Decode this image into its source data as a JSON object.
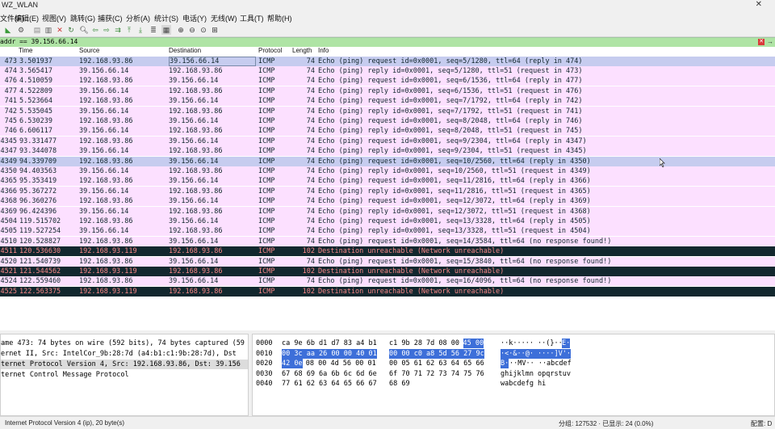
{
  "window": {
    "title": "WZ_WLAN"
  },
  "menu": [
    "文件(F)",
    "编辑(E)",
    "视图(V)",
    "跳转(G)",
    "捕获(C)",
    "分析(A)",
    "统计(S)",
    "电话(Y)",
    "无线(W)",
    "工具(T)",
    "帮助(H)"
  ],
  "filter": {
    "text": "addr == 39.156.66.14"
  },
  "columns": {
    "time": "Time",
    "source": "Source",
    "destination": "Destination",
    "protocol": "Protocol",
    "length": "Length",
    "info": "Info"
  },
  "packets": [
    {
      "no": "473",
      "time": "3.501937",
      "src": "192.168.93.86",
      "dst": "39.156.66.14",
      "proto": "ICMP",
      "len": "74",
      "info": "Echo (ping) request  id=0x0001, seq=5/1280, ttl=64 (reply in 474)",
      "style": "sel"
    },
    {
      "no": "474",
      "time": "3.565417",
      "src": "39.156.66.14",
      "dst": "192.168.93.86",
      "proto": "ICMP",
      "len": "74",
      "info": "Echo (ping) reply    id=0x0001, seq=5/1280, ttl=51 (request in 473)",
      "style": "pink"
    },
    {
      "no": "476",
      "time": "4.510059",
      "src": "192.168.93.86",
      "dst": "39.156.66.14",
      "proto": "ICMP",
      "len": "74",
      "info": "Echo (ping) request  id=0x0001, seq=6/1536, ttl=64 (reply in 477)",
      "style": "pink"
    },
    {
      "no": "477",
      "time": "4.522809",
      "src": "39.156.66.14",
      "dst": "192.168.93.86",
      "proto": "ICMP",
      "len": "74",
      "info": "Echo (ping) reply    id=0x0001, seq=6/1536, ttl=51 (request in 476)",
      "style": "pink"
    },
    {
      "no": "741",
      "time": "5.523664",
      "src": "192.168.93.86",
      "dst": "39.156.66.14",
      "proto": "ICMP",
      "len": "74",
      "info": "Echo (ping) request  id=0x0001, seq=7/1792, ttl=64 (reply in 742)",
      "style": "pink"
    },
    {
      "no": "742",
      "time": "5.535045",
      "src": "39.156.66.14",
      "dst": "192.168.93.86",
      "proto": "ICMP",
      "len": "74",
      "info": "Echo (ping) reply    id=0x0001, seq=7/1792, ttl=51 (request in 741)",
      "style": "pink"
    },
    {
      "no": "745",
      "time": "6.530239",
      "src": "192.168.93.86",
      "dst": "39.156.66.14",
      "proto": "ICMP",
      "len": "74",
      "info": "Echo (ping) request  id=0x0001, seq=8/2048, ttl=64 (reply in 746)",
      "style": "pink"
    },
    {
      "no": "746",
      "time": "6.606117",
      "src": "39.156.66.14",
      "dst": "192.168.93.86",
      "proto": "ICMP",
      "len": "74",
      "info": "Echo (ping) reply    id=0x0001, seq=8/2048, ttl=51 (request in 745)",
      "style": "pink"
    },
    {
      "no": "4345",
      "time": "93.331477",
      "src": "192.168.93.86",
      "dst": "39.156.66.14",
      "proto": "ICMP",
      "len": "74",
      "info": "Echo (ping) request  id=0x0001, seq=9/2304, ttl=64 (reply in 4347)",
      "style": "pink"
    },
    {
      "no": "4347",
      "time": "93.344078",
      "src": "39.156.66.14",
      "dst": "192.168.93.86",
      "proto": "ICMP",
      "len": "74",
      "info": "Echo (ping) reply    id=0x0001, seq=9/2304, ttl=51 (request in 4345)",
      "style": "pink"
    },
    {
      "no": "4349",
      "time": "94.339709",
      "src": "192.168.93.86",
      "dst": "39.156.66.14",
      "proto": "ICMP",
      "len": "74",
      "info": "Echo (ping) request  id=0x0001, seq=10/2560, ttl=64 (reply in 4350)",
      "style": "sel"
    },
    {
      "no": "4350",
      "time": "94.403563",
      "src": "39.156.66.14",
      "dst": "192.168.93.86",
      "proto": "ICMP",
      "len": "74",
      "info": "Echo (ping) reply    id=0x0001, seq=10/2560, ttl=51 (request in 4349)",
      "style": "pink"
    },
    {
      "no": "4365",
      "time": "95.353419",
      "src": "192.168.93.86",
      "dst": "39.156.66.14",
      "proto": "ICMP",
      "len": "74",
      "info": "Echo (ping) request  id=0x0001, seq=11/2816, ttl=64 (reply in 4366)",
      "style": "pink"
    },
    {
      "no": "4366",
      "time": "95.367272",
      "src": "39.156.66.14",
      "dst": "192.168.93.86",
      "proto": "ICMP",
      "len": "74",
      "info": "Echo (ping) reply    id=0x0001, seq=11/2816, ttl=51 (request in 4365)",
      "style": "pink"
    },
    {
      "no": "4368",
      "time": "96.360276",
      "src": "192.168.93.86",
      "dst": "39.156.66.14",
      "proto": "ICMP",
      "len": "74",
      "info": "Echo (ping) request  id=0x0001, seq=12/3072, ttl=64 (reply in 4369)",
      "style": "pink"
    },
    {
      "no": "4369",
      "time": "96.424396",
      "src": "39.156.66.14",
      "dst": "192.168.93.86",
      "proto": "ICMP",
      "len": "74",
      "info": "Echo (ping) reply    id=0x0001, seq=12/3072, ttl=51 (request in 4368)",
      "style": "pink"
    },
    {
      "no": "4504",
      "time": "119.515702",
      "src": "192.168.93.86",
      "dst": "39.156.66.14",
      "proto": "ICMP",
      "len": "74",
      "info": "Echo (ping) request  id=0x0001, seq=13/3328, ttl=64 (reply in 4505)",
      "style": "pink"
    },
    {
      "no": "4505",
      "time": "119.527254",
      "src": "39.156.66.14",
      "dst": "192.168.93.86",
      "proto": "ICMP",
      "len": "74",
      "info": "Echo (ping) reply    id=0x0001, seq=13/3328, ttl=51 (request in 4504)",
      "style": "pink"
    },
    {
      "no": "4510",
      "time": "120.528827",
      "src": "192.168.93.86",
      "dst": "39.156.66.14",
      "proto": "ICMP",
      "len": "74",
      "info": "Echo (ping) request  id=0x0001, seq=14/3584, ttl=64 (no response found!)",
      "style": "pink"
    },
    {
      "no": "4511",
      "time": "120.536630",
      "src": "192.168.93.119",
      "dst": "192.168.93.86",
      "proto": "ICMP",
      "len": "102",
      "info": "Destination unreachable (Network unreachable)",
      "style": "dark"
    },
    {
      "no": "4520",
      "time": "121.540739",
      "src": "192.168.93.86",
      "dst": "39.156.66.14",
      "proto": "ICMP",
      "len": "74",
      "info": "Echo (ping) request  id=0x0001, seq=15/3840, ttl=64 (no response found!)",
      "style": "pink"
    },
    {
      "no": "4521",
      "time": "121.544562",
      "src": "192.168.93.119",
      "dst": "192.168.93.86",
      "proto": "ICMP",
      "len": "102",
      "info": "Destination unreachable (Network unreachable)",
      "style": "dark"
    },
    {
      "no": "4524",
      "time": "122.559460",
      "src": "192.168.93.86",
      "dst": "39.156.66.14",
      "proto": "ICMP",
      "len": "74",
      "info": "Echo (ping) request  id=0x0001, seq=16/4096, ttl=64 (no response found!)",
      "style": "pink"
    },
    {
      "no": "4525",
      "time": "122.563375",
      "src": "192.168.93.119",
      "dst": "192.168.93.86",
      "proto": "ICMP",
      "len": "102",
      "info": "Destination unreachable (Network unreachable)",
      "style": "dark"
    }
  ],
  "details": [
    "ame 473: 74 bytes on wire (592 bits), 74 bytes captured (59",
    "ernet II, Src: IntelCor_9b:28:7d (a4:b1:c1:9b:28:7d), Dst",
    "ternet Protocol Version 4, Src: 192.168.93.86, Dst: 39.156",
    "ternet Control Message Protocol"
  ],
  "bytes": [
    {
      "off": "0000",
      "hex1": "ca 9e 6b d1 d7 83 a4 b1",
      "hex2": "c1 9b 28 7d 08 00",
      "hex2h": "45 00",
      "ascii": "··k·····  ··(}··",
      "asciih": "E·"
    },
    {
      "off": "0010",
      "hex1h": "00 3c aa 26 00 00 40 01",
      "hex2h": "00 00 c0 a8 5d 56 27 9c",
      "asciih": "·<·&··@· ····]V'·"
    },
    {
      "off": "0020",
      "hex1h": "42 0e",
      "hex1": "08 00 4d 56 00 01",
      "hex2": "00 05 61 62 63 64 65 66",
      "asciih": "B·",
      "ascii": "··MV··  ··abcdef"
    },
    {
      "off": "0030",
      "hex1": "67 68 69 6a 6b 6c 6d 6e",
      "hex2": "6f 70 71 72 73 74 75 76",
      "ascii": "ghijklmn opqrstuv"
    },
    {
      "off": "0040",
      "hex1": "77 61 62 63 64 65 66 67",
      "hex2": "68 69",
      "ascii": "wabcdefg hi"
    }
  ],
  "status": {
    "left": "Internet Protocol Version 4 (ip), 20 byte(s)",
    "packets": "分组: 127532 · 已显示: 24 (0.0%)",
    "profile": "配置: D"
  }
}
